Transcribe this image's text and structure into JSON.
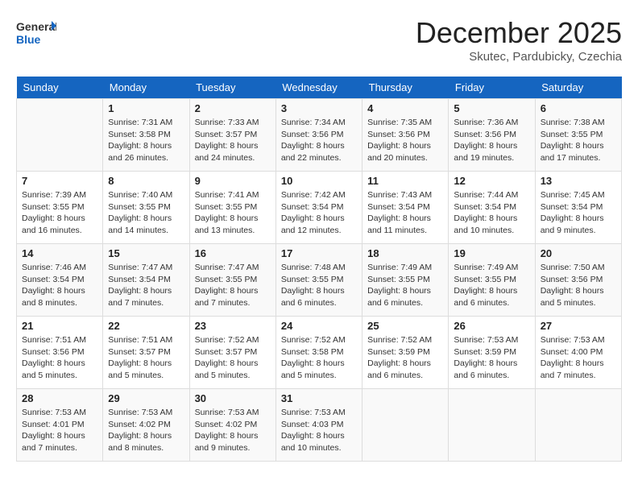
{
  "header": {
    "logo_general": "General",
    "logo_blue": "Blue",
    "month_title": "December 2025",
    "subtitle": "Skutec, Pardubicky, Czechia"
  },
  "days_of_week": [
    "Sunday",
    "Monday",
    "Tuesday",
    "Wednesday",
    "Thursday",
    "Friday",
    "Saturday"
  ],
  "weeks": [
    [
      {
        "num": "",
        "info": ""
      },
      {
        "num": "1",
        "info": "Sunrise: 7:31 AM\nSunset: 3:58 PM\nDaylight: 8 hours and 26 minutes."
      },
      {
        "num": "2",
        "info": "Sunrise: 7:33 AM\nSunset: 3:57 PM\nDaylight: 8 hours and 24 minutes."
      },
      {
        "num": "3",
        "info": "Sunrise: 7:34 AM\nSunset: 3:56 PM\nDaylight: 8 hours and 22 minutes."
      },
      {
        "num": "4",
        "info": "Sunrise: 7:35 AM\nSunset: 3:56 PM\nDaylight: 8 hours and 20 minutes."
      },
      {
        "num": "5",
        "info": "Sunrise: 7:36 AM\nSunset: 3:56 PM\nDaylight: 8 hours and 19 minutes."
      },
      {
        "num": "6",
        "info": "Sunrise: 7:38 AM\nSunset: 3:55 PM\nDaylight: 8 hours and 17 minutes."
      }
    ],
    [
      {
        "num": "7",
        "info": "Sunrise: 7:39 AM\nSunset: 3:55 PM\nDaylight: 8 hours and 16 minutes."
      },
      {
        "num": "8",
        "info": "Sunrise: 7:40 AM\nSunset: 3:55 PM\nDaylight: 8 hours and 14 minutes."
      },
      {
        "num": "9",
        "info": "Sunrise: 7:41 AM\nSunset: 3:55 PM\nDaylight: 8 hours and 13 minutes."
      },
      {
        "num": "10",
        "info": "Sunrise: 7:42 AM\nSunset: 3:54 PM\nDaylight: 8 hours and 12 minutes."
      },
      {
        "num": "11",
        "info": "Sunrise: 7:43 AM\nSunset: 3:54 PM\nDaylight: 8 hours and 11 minutes."
      },
      {
        "num": "12",
        "info": "Sunrise: 7:44 AM\nSunset: 3:54 PM\nDaylight: 8 hours and 10 minutes."
      },
      {
        "num": "13",
        "info": "Sunrise: 7:45 AM\nSunset: 3:54 PM\nDaylight: 8 hours and 9 minutes."
      }
    ],
    [
      {
        "num": "14",
        "info": "Sunrise: 7:46 AM\nSunset: 3:54 PM\nDaylight: 8 hours and 8 minutes."
      },
      {
        "num": "15",
        "info": "Sunrise: 7:47 AM\nSunset: 3:54 PM\nDaylight: 8 hours and 7 minutes."
      },
      {
        "num": "16",
        "info": "Sunrise: 7:47 AM\nSunset: 3:55 PM\nDaylight: 8 hours and 7 minutes."
      },
      {
        "num": "17",
        "info": "Sunrise: 7:48 AM\nSunset: 3:55 PM\nDaylight: 8 hours and 6 minutes."
      },
      {
        "num": "18",
        "info": "Sunrise: 7:49 AM\nSunset: 3:55 PM\nDaylight: 8 hours and 6 minutes."
      },
      {
        "num": "19",
        "info": "Sunrise: 7:49 AM\nSunset: 3:55 PM\nDaylight: 8 hours and 6 minutes."
      },
      {
        "num": "20",
        "info": "Sunrise: 7:50 AM\nSunset: 3:56 PM\nDaylight: 8 hours and 5 minutes."
      }
    ],
    [
      {
        "num": "21",
        "info": "Sunrise: 7:51 AM\nSunset: 3:56 PM\nDaylight: 8 hours and 5 minutes."
      },
      {
        "num": "22",
        "info": "Sunrise: 7:51 AM\nSunset: 3:57 PM\nDaylight: 8 hours and 5 minutes."
      },
      {
        "num": "23",
        "info": "Sunrise: 7:52 AM\nSunset: 3:57 PM\nDaylight: 8 hours and 5 minutes."
      },
      {
        "num": "24",
        "info": "Sunrise: 7:52 AM\nSunset: 3:58 PM\nDaylight: 8 hours and 5 minutes."
      },
      {
        "num": "25",
        "info": "Sunrise: 7:52 AM\nSunset: 3:59 PM\nDaylight: 8 hours and 6 minutes."
      },
      {
        "num": "26",
        "info": "Sunrise: 7:53 AM\nSunset: 3:59 PM\nDaylight: 8 hours and 6 minutes."
      },
      {
        "num": "27",
        "info": "Sunrise: 7:53 AM\nSunset: 4:00 PM\nDaylight: 8 hours and 7 minutes."
      }
    ],
    [
      {
        "num": "28",
        "info": "Sunrise: 7:53 AM\nSunset: 4:01 PM\nDaylight: 8 hours and 7 minutes."
      },
      {
        "num": "29",
        "info": "Sunrise: 7:53 AM\nSunset: 4:02 PM\nDaylight: 8 hours and 8 minutes."
      },
      {
        "num": "30",
        "info": "Sunrise: 7:53 AM\nSunset: 4:02 PM\nDaylight: 8 hours and 9 minutes."
      },
      {
        "num": "31",
        "info": "Sunrise: 7:53 AM\nSunset: 4:03 PM\nDaylight: 8 hours and 10 minutes."
      },
      {
        "num": "",
        "info": ""
      },
      {
        "num": "",
        "info": ""
      },
      {
        "num": "",
        "info": ""
      }
    ]
  ]
}
